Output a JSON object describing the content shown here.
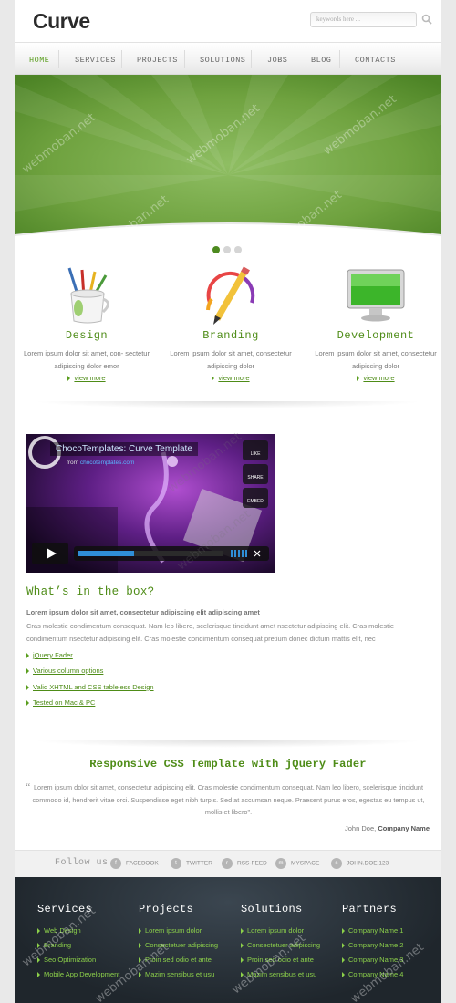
{
  "header": {
    "logo": "Curve",
    "search_placeholder": "keywords here ..."
  },
  "nav": {
    "items": [
      {
        "label": "HOME",
        "active": true
      },
      {
        "label": "SERVICES"
      },
      {
        "label": "PROJECTS"
      },
      {
        "label": "SOLUTIONS"
      },
      {
        "label": "JOBS"
      },
      {
        "label": "BLOG"
      },
      {
        "label": "CONTACTS"
      }
    ]
  },
  "slider": {
    "slide_count": 3,
    "active_slide": 1
  },
  "features": [
    {
      "title": "Design",
      "text": "Lorem ipsum dolor sit amet, con- sectetur adipiscing dolor emor",
      "more": "view more",
      "icon": "paintbrush-cup-icon"
    },
    {
      "title": "Branding",
      "text": "Lorem ipsum dolor sit amet, consectetur adipiscing dolor",
      "more": "view more",
      "icon": "pencil-icon"
    },
    {
      "title": "Development",
      "text": "Lorem ipsum dolor sit amet, consectetur adipiscing dolor",
      "more": "view more",
      "icon": "monitor-icon"
    }
  ],
  "video": {
    "title": "ChocoTemplates: Curve Template",
    "from_label": "from",
    "from_source": "chocotemplates.com",
    "side_buttons": [
      "LIKE",
      "SHARE",
      "EMBED"
    ]
  },
  "box": {
    "title": "What’s in the box?",
    "lead": "Lorem ipsum dolor sit amet, consectetur adipiscing elit adipiscing amet",
    "paragraph": "Cras molestie condimentum consequat. Nam leo libero, scelerisque tincidunt amet nsectetur adipiscing elit. Cras molestie condimentum nsectetur adipiscing elit. Cras molestie condimentum consequat pretium donec dictum mattis elit, nec",
    "links": [
      "jQuery Fader",
      "Various column options",
      "Valid XHTML and CSS tableless Design",
      "Tested on Mac & PC"
    ]
  },
  "testimonial": {
    "title": "Responsive CSS Template with jQuery Fader",
    "text": "Lorem ipsum dolor sit amet, consectetur adipiscing elit. Cras molestie condimentum consequat. Nam leo libero, scelerisque tincidunt commodo id, hendrerit vitae orci. Suspendisse eget nibh turpis. Sed at accumsan neque. Praesent purus eros, egestas eu tempus ut, mollis et libero\".",
    "author_name": "John Doe,",
    "author_company": "Company Name"
  },
  "follow": {
    "label": "Follow us",
    "links": [
      {
        "label": "FACEBOOK",
        "icon": "facebook-icon",
        "glyph": "f"
      },
      {
        "label": "TWITTER",
        "icon": "twitter-icon",
        "glyph": "t"
      },
      {
        "label": "RSS-FEED",
        "icon": "rss-icon",
        "glyph": "r"
      },
      {
        "label": "MYSPACE",
        "icon": "myspace-icon",
        "glyph": "m"
      },
      {
        "label": "JOHN.DOE.123",
        "icon": "skype-icon",
        "glyph": "s"
      }
    ]
  },
  "footer": {
    "columns": [
      {
        "title": "Services",
        "items": [
          "Web Design",
          "Branding",
          "Seo Optimization",
          "Mobile App Development"
        ]
      },
      {
        "title": "Projects",
        "items": [
          "Lorem ipsum dolor",
          "Consectetuer adipiscing",
          "Proin sed odio et ante",
          "Mazim sensibus et usu"
        ]
      },
      {
        "title": "Solutions",
        "items": [
          "Lorem ipsum dolor",
          "Consectetuer adipiscing",
          "Proin sed odio et ante",
          "Mazim sensibus et usu"
        ]
      },
      {
        "title": "Partners",
        "items": [
          "Company Name 1",
          "Company Name 2",
          "Company Name 3",
          "Company Name 4"
        ]
      }
    ]
  },
  "watermark": "webmoban.net",
  "colors": {
    "accent_green": "#4e8c17",
    "footer_link": "#8cd04a",
    "footer_bg": "#1f262c"
  }
}
